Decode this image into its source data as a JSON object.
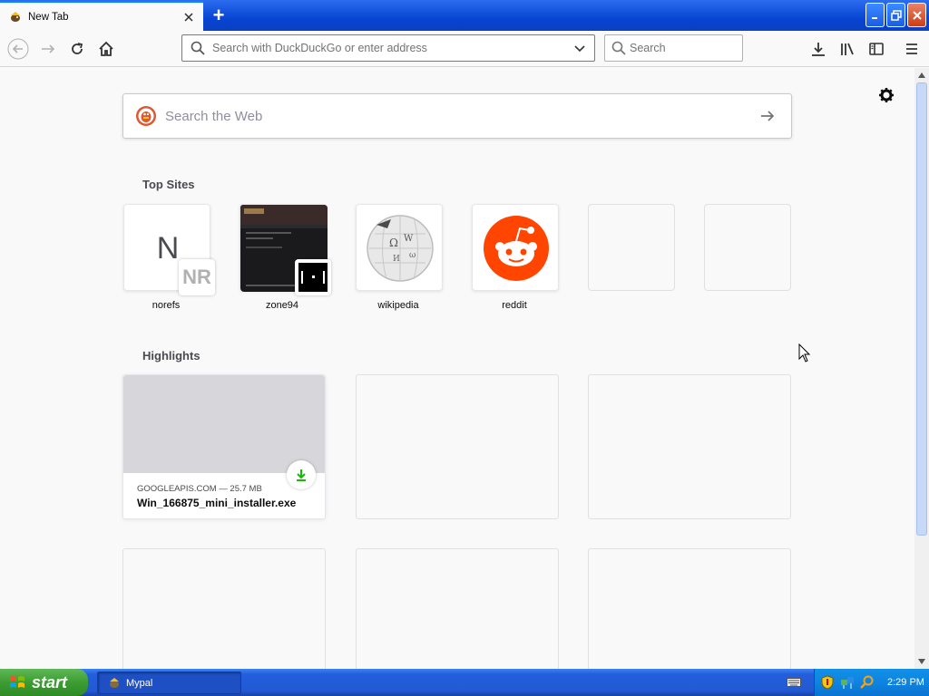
{
  "browser": {
    "tab_title": "New Tab",
    "new_tab_symbol": "+",
    "window_controls": {
      "minimize": "_",
      "maximize": "❐",
      "close": "✕"
    }
  },
  "navbar": {
    "url_placeholder": "Search with DuckDuckGo or enter address",
    "search_placeholder": "Search"
  },
  "newtab": {
    "web_search_placeholder": "Search the Web",
    "top_sites_heading": "Top Sites",
    "top_sites": [
      {
        "label": "norefs",
        "letter": "N",
        "badge": "NR"
      },
      {
        "label": "zone94"
      },
      {
        "label": "wikipedia"
      },
      {
        "label": "reddit"
      }
    ],
    "highlights_heading": "Highlights",
    "highlight": {
      "meta": "GOOGLEAPIS.COM — 25.7 MB",
      "title": "Win_166875_mini_installer.exe"
    }
  },
  "taskbar": {
    "start_label": "start",
    "task_label": "Mypal",
    "clock": "2:29 PM"
  },
  "colors": {
    "accent": "#0a84ff",
    "reddit": "#ff4500",
    "download_green": "#12bc00"
  }
}
